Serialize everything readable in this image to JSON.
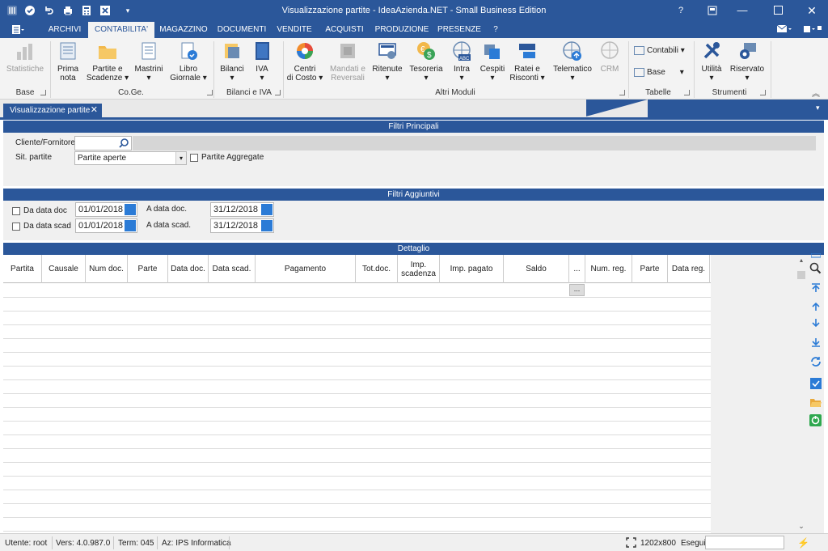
{
  "window": {
    "title": "Visualizzazione partite - IdeaAzienda.NET - Small Business Edition",
    "help_label": "?"
  },
  "menu": {
    "tabs": [
      "ARCHIVI",
      "CONTABILITA'",
      "MAGAZZINO",
      "DOCUMENTI",
      "VENDITE",
      "ACQUISTI",
      "PRODUZIONE",
      "PRESENZE",
      "?"
    ],
    "active": "CONTABILITA'"
  },
  "ribbon": {
    "buttons": {
      "statistiche": "Statistiche",
      "prima_nota": "Prima\nnota",
      "partite_scadenze": "Partite e\nScadenze ▾",
      "mastrini": "Mastrini\n▾",
      "libro_giornale": "Libro\nGiornale ▾",
      "bilanci": "Bilanci\n▾",
      "iva": "IVA\n▾",
      "centri_costo": "Centri\ndi Costo ▾",
      "mandati_reversali": "Mandati e\nReversali",
      "ritenute": "Ritenute\n▾",
      "tesoreria": "Tesoreria\n▾",
      "intra": "Intra\n▾",
      "cespiti": "Cespiti\n▾",
      "ratei_risconti": "Ratei e\nRisconti ▾",
      "telematico": "Telematico\n▾",
      "crm": "CRM",
      "contabili": "Contabili ▾",
      "base": "Base",
      "utilita": "Utilità\n▾",
      "riservato": "Riservato\n▾"
    },
    "groups": {
      "base": "Base",
      "coge": "Co.Ge.",
      "bilanci_iva": "Bilanci e IVA",
      "altri_moduli": "Altri Moduli",
      "tabelle": "Tabelle",
      "strumenti": "Strumenti"
    }
  },
  "doc_tab": {
    "label": "Visualizzazione partite",
    "close": "✕"
  },
  "filtri_principali": {
    "header": "Filtri Principali",
    "cliente_label": "Cliente/Fornitore",
    "cliente_value": "",
    "sit_label": "Sit. partite",
    "sit_value": "Partite aperte",
    "aggregate_label": "Partite Aggregate",
    "aggregate_checked": false
  },
  "filtri_aggiuntivi": {
    "header": "Filtri Aggiuntivi",
    "da_data_doc_label": "Da data doc",
    "da_data_doc_value": "01/01/2018",
    "a_data_doc_label": "A data doc.",
    "a_data_doc_value": "31/12/2018",
    "da_data_scad_label": "Da data scad",
    "da_data_scad_value": "01/01/2018",
    "a_data_scad_label": "A data scad.",
    "a_data_scad_value": "31/12/2018"
  },
  "dettaglio": {
    "header": "Dettaglio",
    "columns": [
      "Partita",
      "Causale",
      "Num doc.",
      "Parte",
      "Data doc.",
      "Data scad.",
      "Pagamento",
      "Tot.doc.",
      "Imp. scadenza",
      "Imp. pagato",
      "Saldo",
      "...",
      "Num. reg.",
      "Parte",
      "Data reg."
    ],
    "filter_button": "..."
  },
  "status": {
    "utente": "Utente: root",
    "versione": "Vers: 4.0.987.0",
    "terminale": "Term: 045",
    "azienda": "Az: IPS Informatica",
    "resolution": "1202x800",
    "esegui_label": "Esegui"
  },
  "colors": {
    "accent": "#2b579a",
    "ribbon_bg": "#f3f3f3",
    "panel_bg": "#f0f0f0"
  }
}
